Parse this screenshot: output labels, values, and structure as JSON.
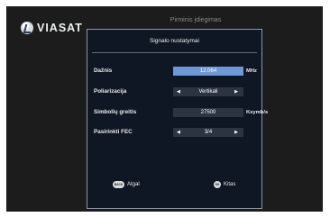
{
  "window": {
    "title": "Pirminis įdiegimas"
  },
  "logo": {
    "text": "VIASAT"
  },
  "panel": {
    "header": "Signalo nustatymai",
    "fields": [
      {
        "label": "Dažnis",
        "value": "12.064",
        "unit": "MHz",
        "active": true,
        "arrows": false
      },
      {
        "label": "Poliarizacija",
        "value": "Vertikali",
        "unit": "",
        "active": false,
        "arrows": true
      },
      {
        "label": "Simbolių greitis",
        "value": "27500",
        "unit": "Ksymb/s",
        "active": false,
        "arrows": false
      },
      {
        "label": "Pasirinkti FEC",
        "value": "3/4",
        "unit": "",
        "active": false,
        "arrows": true
      }
    ]
  },
  "footer": {
    "back_key": "BACK",
    "back_label": "Atgal",
    "next_key": "OK",
    "next_label": "Kitas"
  },
  "colors": {
    "panel_bg": "#0f1724",
    "panel_border": "#8b98ab",
    "active_field": "#6e98d6",
    "field": "#2c3442",
    "screen_bg": "#1c1c1c"
  },
  "icons": {
    "left_arrow": "left-arrow-icon",
    "right_arrow": "right-arrow-icon",
    "logo": "viasat-logo-icon"
  }
}
